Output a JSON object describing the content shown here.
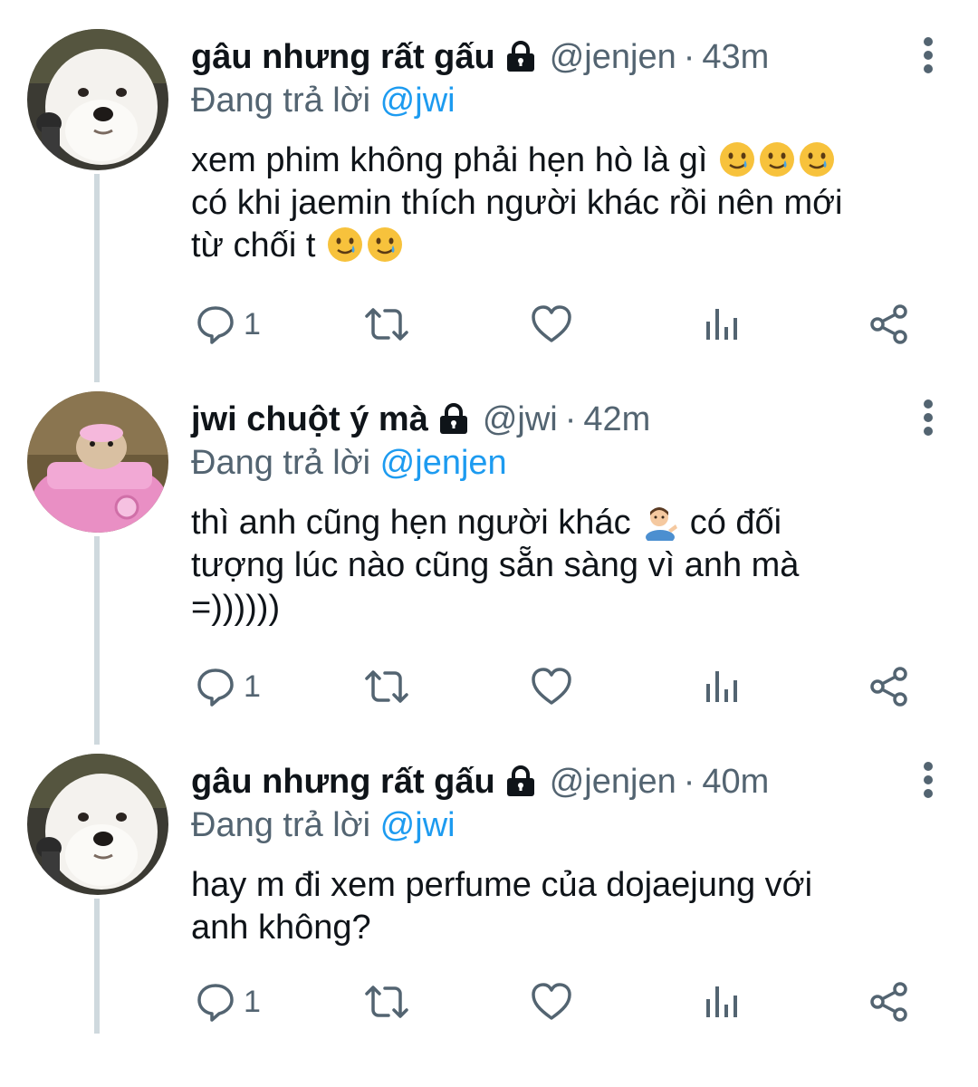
{
  "tweets": [
    {
      "display_name": "gâu nhưng rất gấu",
      "handle": "@jenjen",
      "separator": "·",
      "time": "43m",
      "replying_prefix": "Đang trả lời",
      "replying_to": "@jwi",
      "lines": [
        {
          "text": "xem phim không phải hẹn hò là gì",
          "emojis": [
            "smiling-tear-emoji",
            "smiling-tear-emoji",
            "smiling-tear-emoji"
          ]
        },
        {
          "text": "có khi jaemin thích người khác rồi nên mới",
          "emojis": []
        },
        {
          "text": "từ chối t",
          "emojis": [
            "smiling-tear-emoji",
            "smiling-tear-emoji"
          ]
        }
      ],
      "reply_count": "1",
      "avatar_icon": "white-dog-avatar"
    },
    {
      "display_name": "jwi chuột ý mà",
      "handle": "@jwi",
      "separator": "·",
      "time": "42m",
      "replying_prefix": "Đang trả lời",
      "replying_to": "@jenjen",
      "lines": [
        {
          "text": "thì anh cũng hẹn người khác",
          "emojis": [
            "person-tipping-hand-emoji"
          ],
          "suffix": "có đối"
        },
        {
          "text": "tượng lúc nào cũng sẵn sàng vì anh mà",
          "emojis": []
        },
        {
          "text": "=))))))",
          "emojis": []
        }
      ],
      "reply_count": "1",
      "avatar_icon": "hamster-pink-car-avatar"
    },
    {
      "display_name": "gâu nhưng rất gấu",
      "handle": "@jenjen",
      "separator": "·",
      "time": "40m",
      "replying_prefix": "Đang trả lời",
      "replying_to": "@jwi",
      "lines": [
        {
          "text": "hay m đi xem perfume của dojaejung với",
          "emojis": []
        },
        {
          "text": "anh không?",
          "emojis": []
        }
      ],
      "reply_count": "1",
      "avatar_icon": "white-dog-avatar"
    }
  ],
  "icons": {
    "reply": "reply-icon",
    "retweet": "retweet-icon",
    "like": "heart-icon",
    "views": "analytics-icon",
    "share": "share-icon",
    "more": "more-vertical-icon",
    "lock": "lock-icon"
  },
  "colors": {
    "text": "#0f1419",
    "secondary": "#536471",
    "link": "#1d9bf0",
    "thread_line": "#cfd9de"
  }
}
